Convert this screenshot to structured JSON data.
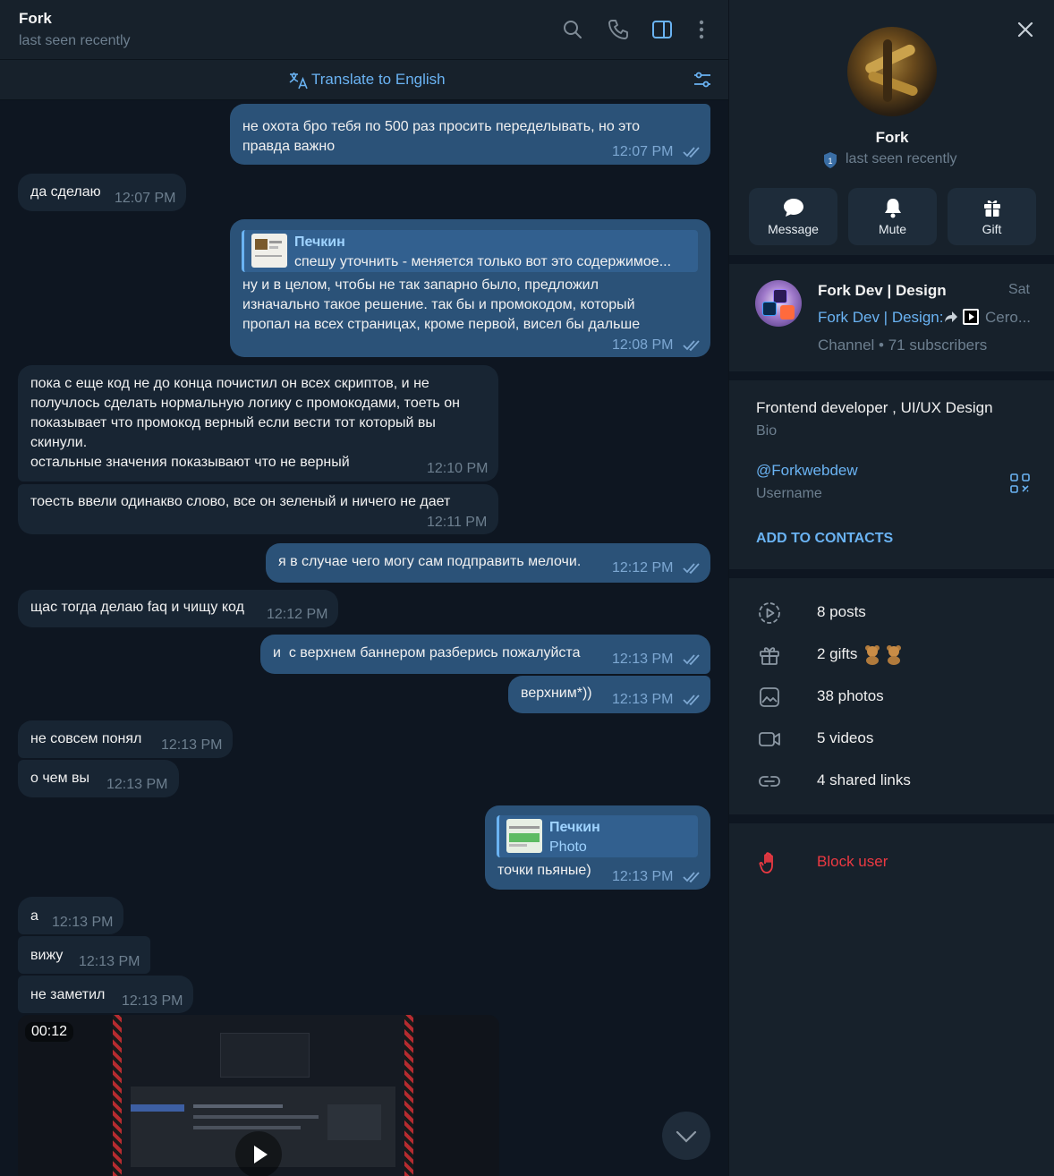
{
  "header": {
    "name": "Fork",
    "status": "last seen recently",
    "translate_label": "Translate to English"
  },
  "messages": [
    {
      "dir": "out",
      "text": "не охота бро тебя по 500 раз просить переделывать, но это\nправда важно",
      "time": "12:07 PM"
    },
    {
      "dir": "in",
      "text": "да сделаю",
      "time": "12:07 PM"
    },
    {
      "dir": "out",
      "reply_name": "Печкин",
      "reply_text": "спешу уточнить - меняется только вот это содержимое...",
      "text": "ну и в целом, чтобы не так запарно было, предложил\nизначально такое решение. так бы и промокодом, который\nпропал на всех страницах, кроме первой, висел бы дальше",
      "time": "12:08 PM"
    },
    {
      "dir": "in",
      "text": "пока с еще код не до конца почистил он всех скриптов, и не\nполучлось сделать нормальную логику с промокодами, тоеть он\nпоказывает что промокод верный если вести тот который вы\nскинули.\nостальные значения показывают что не верный",
      "time": "12:10 PM"
    },
    {
      "dir": "in",
      "text": "тоесть ввели одинакво слово, все он зеленый и ничего не дает",
      "time": "12:11 PM"
    },
    {
      "dir": "out",
      "text": "я в случае чего могу сам подправить мелочи.",
      "time": "12:12 PM"
    },
    {
      "dir": "in",
      "text": "щас тогда делаю faq и чищу код",
      "time": "12:12 PM"
    },
    {
      "dir": "out",
      "text": "и  с верхнем баннером разберись пожалуйста",
      "time": "12:13 PM"
    },
    {
      "dir": "out",
      "text": "верхним*))",
      "time": "12:13 PM"
    },
    {
      "dir": "in",
      "text": "не совсем понял",
      "time": "12:13 PM"
    },
    {
      "dir": "in",
      "text": "о чем вы",
      "time": "12:13 PM"
    },
    {
      "dir": "out",
      "reply_name": "Печкин",
      "reply_text": "Photo",
      "text": "точки пьяные)",
      "time": "12:13 PM"
    },
    {
      "dir": "in",
      "text": "а",
      "time": "12:13 PM"
    },
    {
      "dir": "in",
      "text": "вижу",
      "time": "12:13 PM"
    },
    {
      "dir": "in",
      "text": "не заметил",
      "time": "12:13 PM"
    }
  ],
  "video": {
    "duration": "00:12"
  },
  "profile": {
    "name": "Fork",
    "status": "last seen recently",
    "actions": [
      "Message",
      "Mute",
      "Gift"
    ],
    "channel": {
      "title": "Fork Dev | Design",
      "date": "Sat",
      "preview_name": "Fork Dev | Design:",
      "preview_text": "Cero...",
      "meta": "Channel • 71 subscribers"
    },
    "bio": "Frontend developer , UI/UX Design",
    "bio_label": "Bio",
    "username": "@Forkwebdew",
    "username_label": "Username",
    "add_contacts": "ADD TO CONTACTS",
    "stats": [
      "8 posts",
      "2 gifts",
      "38 photos",
      "5 videos",
      "4 shared links"
    ],
    "block": "Block user"
  },
  "colors": {
    "accent": "#6ab3f3",
    "danger": "#ec3942",
    "bubble_out": "#2b5278",
    "bubble_in": "#182533"
  }
}
